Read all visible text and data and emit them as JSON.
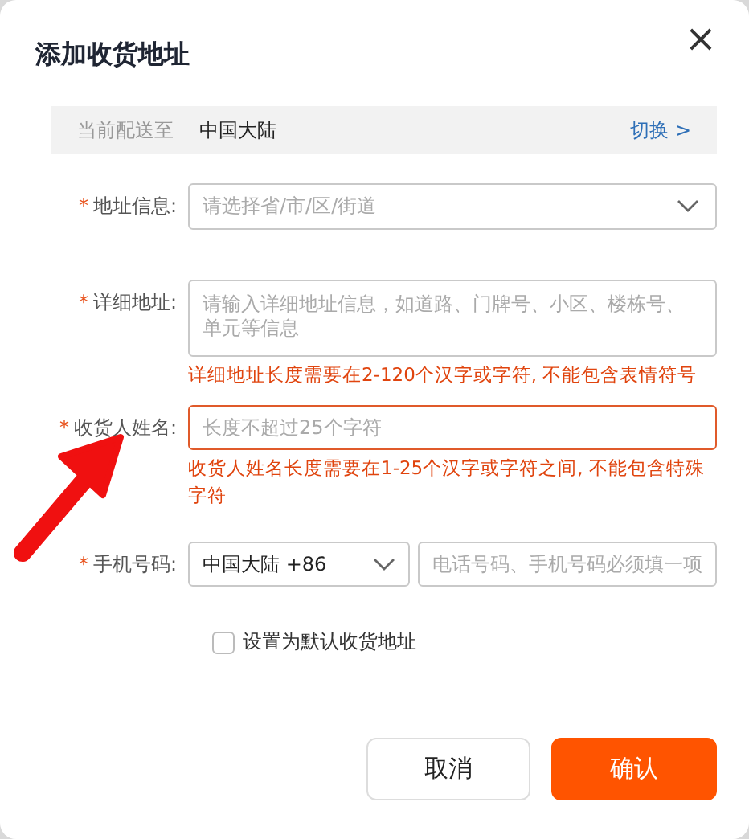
{
  "dialog": {
    "title": "添加收货地址",
    "close_symbol": "×"
  },
  "banner": {
    "label": "当前配送至",
    "value": "中国大陆",
    "link": "切换 >"
  },
  "fields": [
    {
      "kind": "select",
      "required_mark": "*",
      "label": "地址信息:",
      "placeholder": "请选择省/市/区/街道",
      "invalid": false
    },
    {
      "kind": "textarea",
      "required_mark": "*",
      "label": "详细地址:",
      "placeholder": "请输入详细地址信息，如道路、门牌号、小区、楼栋号、单元等信息",
      "invalid": false,
      "error": "详细地址长度需要在2-120个汉字或字符, 不能包含表情符号"
    },
    {
      "kind": "input",
      "required_mark": "*",
      "label": "收货人姓名:",
      "placeholder": "长度不超过25个字符",
      "invalid": true,
      "error": "收货人姓名长度需要在1-25个汉字或字符之间, 不能包含特殊字符"
    },
    {
      "kind": "phone",
      "required_mark": "*",
      "label": "手机号码:",
      "region": "中国大陆 +86",
      "placeholder": "电话号码、手机号码必须填一项",
      "invalid": false
    }
  ],
  "default_checkbox": {
    "label": "设置为默认收货地址",
    "checked": false
  },
  "buttons": [
    {
      "kind": "secondary",
      "label": "取消"
    },
    {
      "kind": "primary",
      "label": "确认"
    }
  ]
}
